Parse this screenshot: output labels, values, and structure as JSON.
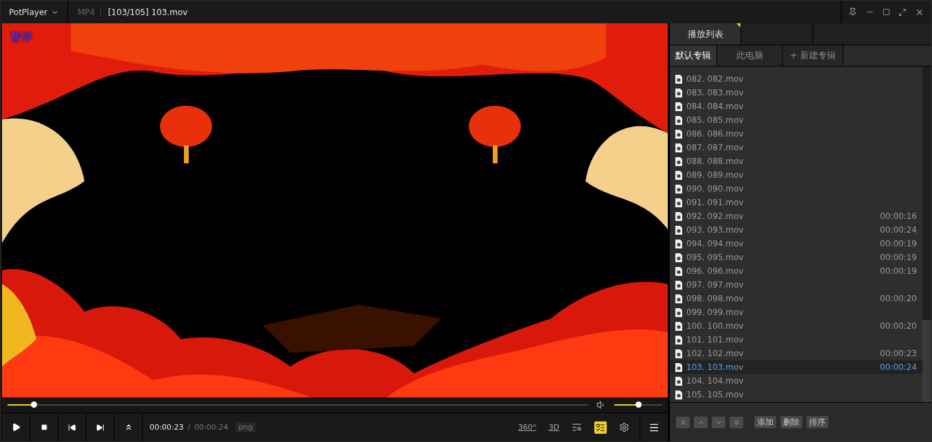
{
  "titlebar": {
    "app": "PotPlayer",
    "format": "MP4",
    "title": "[103/105] 103.mov"
  },
  "osd": "暂停",
  "seek": {
    "level": 0.045
  },
  "volume": {
    "level": 0.5
  },
  "time": {
    "current": "00:00:23",
    "separator": "/",
    "total": "00:00:24",
    "badge": "png"
  },
  "toolbar": [
    {
      "kind": "text",
      "label": "360°",
      "on": false
    },
    {
      "kind": "text",
      "label": "3D",
      "on": false
    },
    {
      "kind": "search",
      "on": false
    },
    {
      "kind": "list",
      "on": true
    },
    {
      "kind": "gear",
      "on": false
    }
  ],
  "panel_tabs": [
    {
      "label": "播放列表",
      "selected": true
    }
  ],
  "albums": [
    {
      "label": "默认专辑",
      "selected": true
    },
    {
      "label": "此电脑",
      "selected": false
    },
    {
      "label": "+ 新建专辑",
      "selected": false
    }
  ],
  "playlist": [
    {
      "name": "082. 082.mov",
      "selected": false
    },
    {
      "name": "083. 083.mov",
      "selected": false
    },
    {
      "name": "084. 084.mov",
      "selected": false
    },
    {
      "name": "085. 085.mov",
      "selected": false
    },
    {
      "name": "086. 086.mov",
      "selected": false
    },
    {
      "name": "087. 087.mov",
      "selected": false
    },
    {
      "name": "088. 088.mov",
      "selected": false
    },
    {
      "name": "089. 089.mov",
      "selected": false
    },
    {
      "name": "090. 090.mov",
      "selected": false
    },
    {
      "name": "091. 091.mov",
      "selected": false
    },
    {
      "name": "092. 092.mov",
      "duration": "00:00:16",
      "selected": false
    },
    {
      "name": "093. 093.mov",
      "duration": "00:00:24",
      "selected": false
    },
    {
      "name": "094. 094.mov",
      "duration": "00:00:19",
      "selected": false
    },
    {
      "name": "095. 095.mov",
      "duration": "00:00:19",
      "selected": false
    },
    {
      "name": "096. 096.mov",
      "duration": "00:00:19",
      "selected": false
    },
    {
      "name": "097. 097.mov",
      "selected": false
    },
    {
      "name": "098. 098.mov",
      "duration": "00:00:20",
      "selected": false
    },
    {
      "name": "099. 099.mov",
      "selected": false
    },
    {
      "name": "100. 100.mov",
      "duration": "00:00:20",
      "selected": false
    },
    {
      "name": "101. 101.mov",
      "selected": false
    },
    {
      "name": "102. 102.mov",
      "duration": "00:00:23",
      "selected": false
    },
    {
      "name": "103. 103.mov",
      "duration": "00:00:24",
      "selected": true
    },
    {
      "name": "104. 104.mov",
      "selected": false
    },
    {
      "name": "105. 105.mov",
      "selected": false
    }
  ],
  "list_buttons": [
    "添加",
    "删除",
    "排序"
  ]
}
